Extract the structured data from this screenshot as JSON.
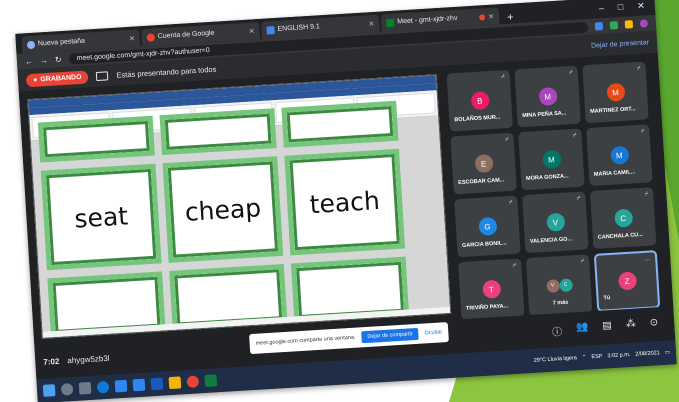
{
  "tabs": [
    {
      "label": "Nueva pestaña",
      "icon": "chrome-icon"
    },
    {
      "label": "Cuenta de Google",
      "icon": "google-icon"
    },
    {
      "label": "ENGLISH 9.1",
      "icon": "word-icon"
    },
    {
      "label": "Meet - gmt-xjdr-zhv",
      "icon": "meet-icon"
    }
  ],
  "address": {
    "url": "meet.google.com/gmt-xjdr-zhv?authuser=0"
  },
  "banner": {
    "rec_label": "GRABANDO",
    "presenting": "Estás presentando para todos",
    "stop": "Dejar de presentar"
  },
  "document": {
    "cards": [
      "seat",
      "cheap",
      "teach"
    ]
  },
  "participants": [
    {
      "initial": "B",
      "name": "BOLAÑOS MUR...",
      "color": "#e91e63"
    },
    {
      "initial": "M",
      "name": "MINA PEÑA SA...",
      "color": "#ab47bc"
    },
    {
      "initial": "M",
      "name": "MARTINEZ ORT...",
      "color": "#e64a19"
    },
    {
      "initial": "E",
      "name": "ESCOBAR CAM...",
      "color": "#8d6e63"
    },
    {
      "initial": "M",
      "name": "MORA GONZA...",
      "color": "#00796b"
    },
    {
      "initial": "M",
      "name": "MARIA CAMIL...",
      "color": "#1976d2"
    },
    {
      "initial": "G",
      "name": "GARCIA BONIL...",
      "color": "#1e88e5"
    },
    {
      "initial": "V",
      "name": "VALENCIA GO...",
      "color": "#26a69a"
    },
    {
      "initial": "C",
      "name": "CANCHALA CU...",
      "color": "#26a69a"
    },
    {
      "initial": "T",
      "name": "TRIVIÑO PAYA...",
      "color": "#ec407a"
    },
    {
      "initial": "",
      "name": "7 más",
      "color": "#3c4043"
    },
    {
      "initial": "Z",
      "name": "Tú",
      "color": "#ec407a"
    }
  ],
  "more_avatars": [
    "V",
    "C"
  ],
  "bottom": {
    "time": "7:02",
    "code": "ahygw5zb3l",
    "toast_text": "meet.google.com comparte una ventana.",
    "toast_share": "Dejar de compartir",
    "toast_hide": "Ocultar"
  },
  "taskbar": {
    "weather": "29°C Lluvia ligera",
    "lang": "ESP",
    "clock": "3:02 p.m.",
    "date": "2/08/2021"
  }
}
